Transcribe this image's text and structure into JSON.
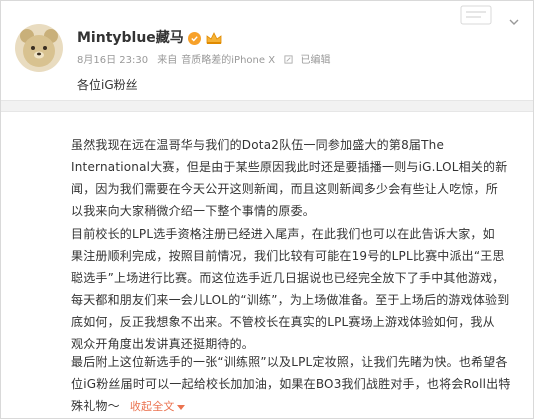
{
  "post": {
    "username": "Mintyblue藏马",
    "meta": {
      "date": "8月16日 23:30",
      "source_prefix": "来自",
      "source": "音质略差的iPhone X",
      "edited": "已编辑"
    },
    "greeting": "各位iG粉丝"
  },
  "article": {
    "p1": [
      "虽然我现在远在温哥华与我们的Dota2队伍一同参加盛大的第8届The",
      "International大赛，但是由于某些原因我此时还是要插播一则与iG.LOL相关的新",
      "闻，因为我们需要在今天公开这则新闻，而且这则新闻多少会有些让人吃惊，所",
      "以我来向大家稍微介绍一下整个事情的原委。"
    ],
    "p2": [
      "目前校长的LPL选手资格注册已经进入尾声，在此我们也可以在此告诉大家，如",
      "果注册顺利完成，按照目前情况，我们比较有可能在19号的LPL比赛中派出“王思",
      "聪选手”上场进行比赛。而这位选手近几日据说也已经完全放下了手中其他游戏，",
      "每天都和朋友们来一会儿LOL的“训练”，为上场做准备。至于上场后的游戏体验到",
      "底如何，反正我想象不出来。不管校长在真实的LPL赛场上游戏体验如何，我从",
      "观众开角度出发讲真还挺期待的。"
    ],
    "p3": [
      "最后附上这位新选手的一张“训练照”以及LPL定妆照，让我们先睹为快。也希望各",
      "位iG粉丝届时可以一起给校长加加油，如果在BO3我们战胜对手，也将会Roll出特",
      "殊礼物～"
    ],
    "collapse_label": "收起全文"
  },
  "colors": {
    "link": "#eb7350",
    "badge": "#f7a12a",
    "meta": "#999999"
  }
}
